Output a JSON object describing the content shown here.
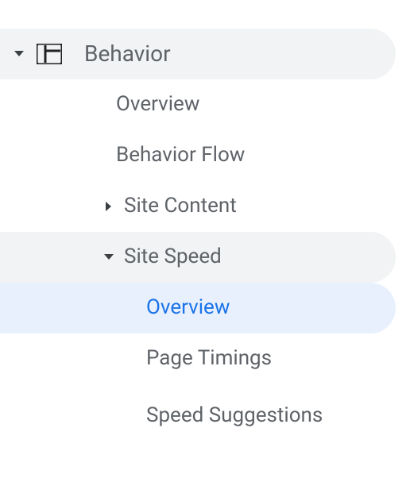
{
  "nav": {
    "behavior": {
      "label": "Behavior",
      "items": [
        {
          "label": "Overview"
        },
        {
          "label": "Behavior Flow"
        },
        {
          "label": "Site Content",
          "expanded": false
        },
        {
          "label": "Site Speed",
          "expanded": true,
          "items": [
            {
              "label": "Overview",
              "selected": true
            },
            {
              "label": "Page Timings"
            },
            {
              "label": "Speed Suggestions"
            }
          ]
        }
      ]
    }
  }
}
